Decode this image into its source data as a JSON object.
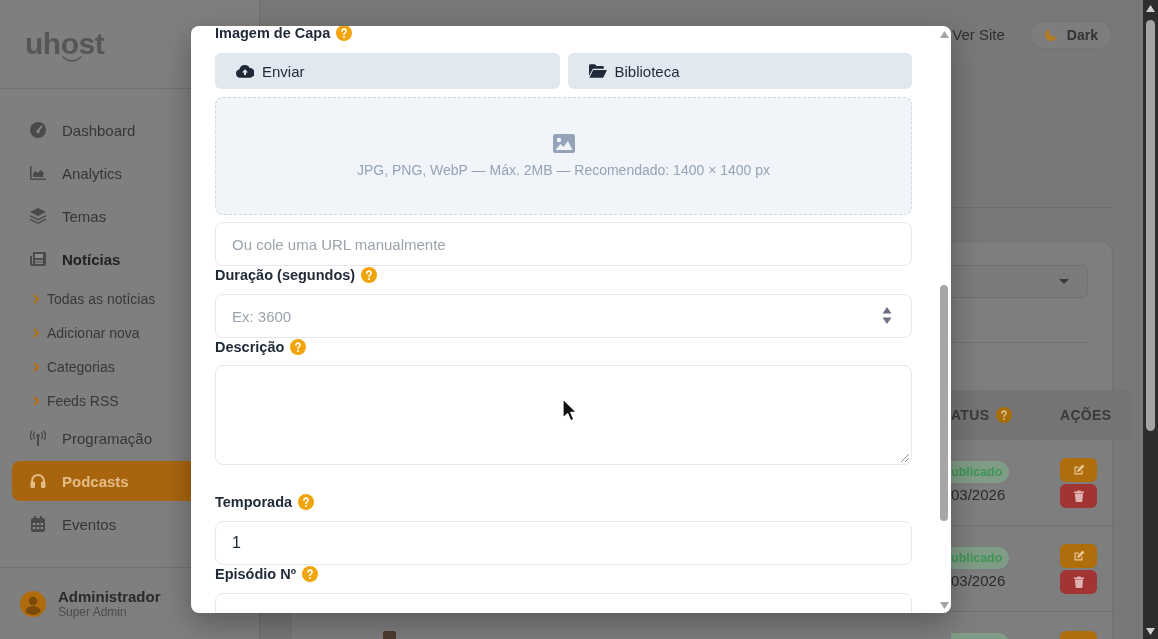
{
  "sidebar": {
    "logo": "uhost",
    "items": [
      {
        "label": "Dashboard",
        "selected": false,
        "expanded": false
      },
      {
        "label": "Analytics",
        "selected": false,
        "expanded": false
      },
      {
        "label": "Temas",
        "selected": false,
        "expanded": false
      },
      {
        "label": "Notícias",
        "selected": false,
        "expanded": true,
        "children": [
          {
            "label": "Todas as notícias",
            "selected": false
          },
          {
            "label": "Adicionar nova",
            "selected": false
          },
          {
            "label": "Categorias",
            "selected": false
          },
          {
            "label": "Feeds RSS",
            "selected": false
          }
        ]
      },
      {
        "label": "Programação",
        "selected": false,
        "expanded": false
      },
      {
        "label": "Podcasts",
        "selected": true,
        "expanded": false
      },
      {
        "label": "Eventos",
        "selected": false,
        "expanded": false
      }
    ],
    "user": {
      "name": "Administrador",
      "role": "Super Admin"
    }
  },
  "topbar": {
    "link": "Ver Site",
    "theme_button": "Dark"
  },
  "table": {
    "columns": [
      {
        "label": "ATUS",
        "help": true
      },
      {
        "label": "AÇÕES",
        "help": false
      }
    ],
    "rows": [
      {
        "status": "ublicado",
        "date": "03/2026",
        "cut_off": false
      },
      {
        "status": "ublicado",
        "date": "03/2026",
        "cut_off": false
      },
      {
        "cut_off": true
      }
    ]
  },
  "modal": {
    "fields": [
      {
        "kind": "image",
        "label": "Imagem de Capa",
        "help": true,
        "buttons": [
          "Enviar",
          "Biblioteca"
        ],
        "dropzone_hint": "JPG, PNG, WebP — Máx. 2MB — Recomendado: 1400 × 1400 px",
        "url_placeholder": "Ou cole uma URL manualmente"
      },
      {
        "kind": "number",
        "label": "Duração (segundos)",
        "help": true,
        "placeholder": "Ex: 3600"
      },
      {
        "kind": "textarea",
        "label": "Descrição",
        "help": true
      },
      {
        "kind": "text",
        "label": "Temporada",
        "help": true,
        "value": "1"
      },
      {
        "kind": "text",
        "label": "Episódio Nº",
        "help": true
      }
    ]
  }
}
